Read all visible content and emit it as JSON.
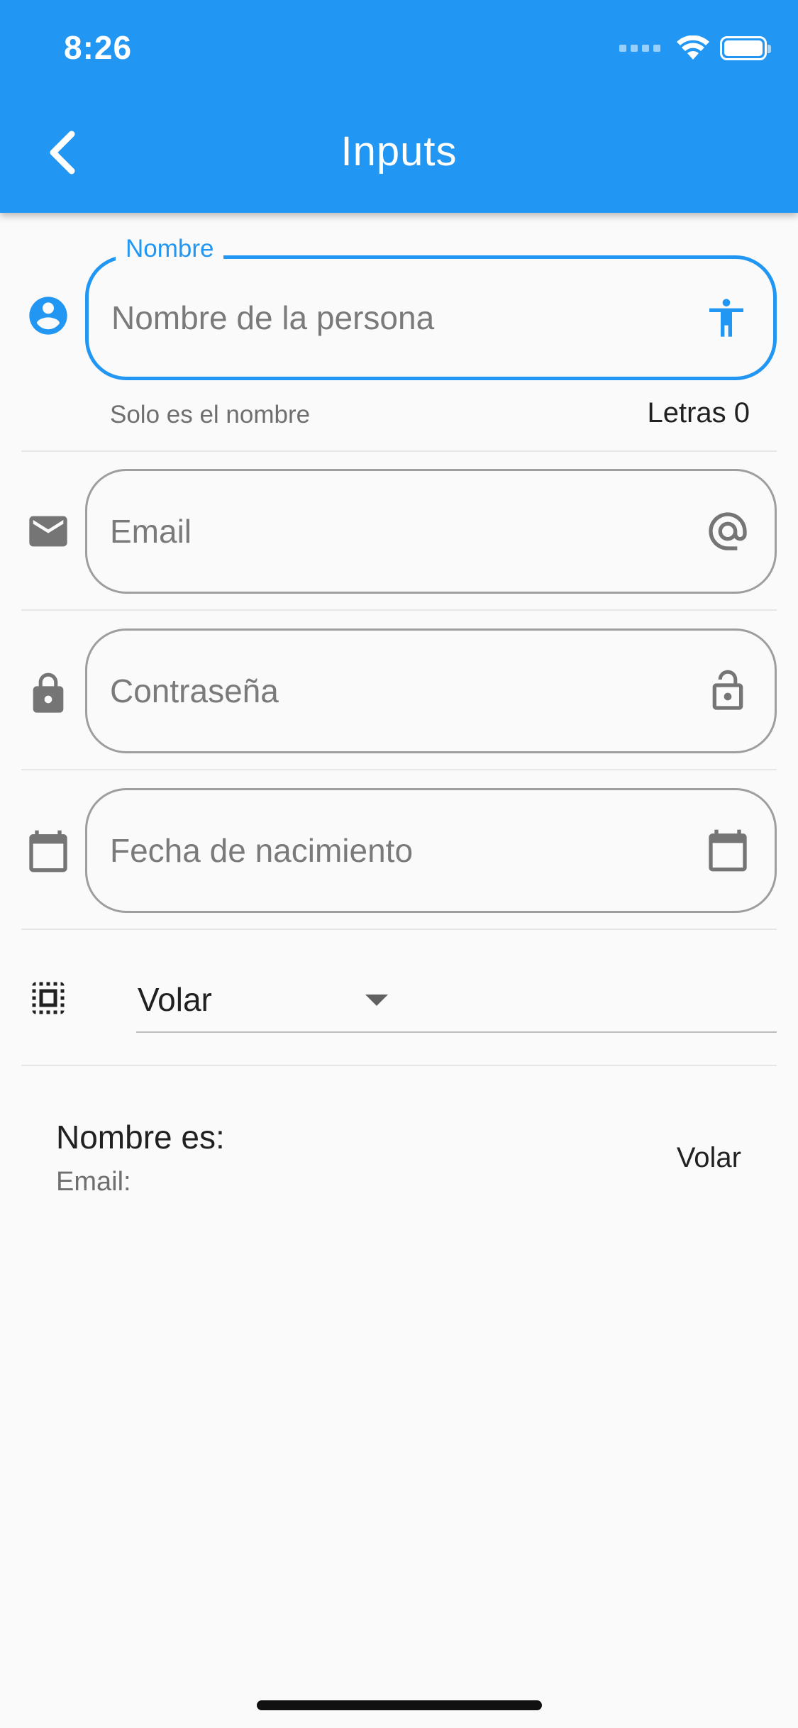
{
  "status_bar": {
    "time": "8:26"
  },
  "app_bar": {
    "title": "Inputs",
    "back_icon": "chevron-left-icon"
  },
  "colors": {
    "primary": "#2196F3",
    "outline": "#9E9E9E",
    "icon_grey": "#757575",
    "background": "#FAFAFA"
  },
  "name_field": {
    "label": "Nombre",
    "placeholder": "Nombre de la persona",
    "helper": "Solo es el nombre",
    "counter": "Letras 0",
    "leading_icon": "account-circle-icon",
    "trailing_icon": "accessibility-icon"
  },
  "email_field": {
    "placeholder": "Email",
    "leading_icon": "mail-icon",
    "trailing_icon": "at-sign-icon"
  },
  "password_field": {
    "placeholder": "Contraseña",
    "leading_icon": "lock-icon",
    "trailing_icon": "lock-open-icon"
  },
  "birthdate_field": {
    "placeholder": "Fecha de nacimiento",
    "leading_icon": "calendar-icon",
    "trailing_icon": "calendar-icon"
  },
  "dropdown": {
    "value": "Volar",
    "leading_icon": "select-all-icon"
  },
  "summary": {
    "title": "Nombre es:",
    "subtitle": "Email:",
    "trailing": "Volar"
  }
}
